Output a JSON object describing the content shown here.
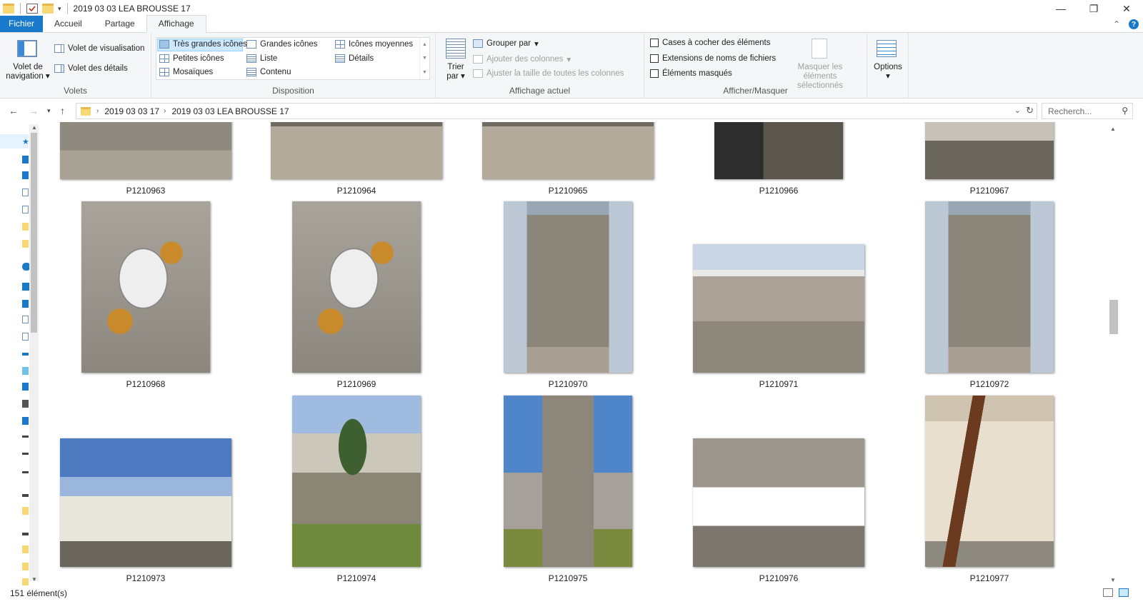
{
  "window": {
    "title": "2019 03 03 LEA BROUSSE 17",
    "controls": {
      "minimize": "—",
      "restore": "❐",
      "close": "✕"
    }
  },
  "ribbon_tabs": [
    {
      "label": "Fichier",
      "active": false
    },
    {
      "label": "Accueil",
      "active": false
    },
    {
      "label": "Partage",
      "active": false
    },
    {
      "label": "Affichage",
      "active": true
    }
  ],
  "ribbon": {
    "volets": {
      "label": "Volets",
      "nav_pane_label": "Volet de navigation",
      "preview_pane": "Volet de visualisation",
      "details_pane": "Volet des détails"
    },
    "disposition": {
      "label": "Disposition",
      "layouts": [
        "Très grandes icônes",
        "Grandes icônes",
        "Icônes moyennes",
        "Petites icônes",
        "Liste",
        "Détails",
        "Mosaïques",
        "Contenu"
      ],
      "selected": "Très grandes icônes"
    },
    "affichage_actuel": {
      "label": "Affichage actuel",
      "sort_by": "Trier par",
      "group_by": "Grouper par",
      "add_columns": "Ajouter des colonnes",
      "size_columns": "Ajuster la taille de toutes les colonnes"
    },
    "afficher_masquer": {
      "label": "Afficher/Masquer",
      "checkboxes": [
        "Cases à cocher des éléments",
        "Extensions de noms de fichiers",
        "Éléments masqués"
      ],
      "hide_selected": "Masquer les éléments sélectionnés"
    },
    "options": {
      "label": "Options"
    }
  },
  "address": {
    "breadcrumbs": [
      "2019 03 03  17",
      "2019 03 03 LEA BROUSSE 17"
    ],
    "search_placeholder": "Recherch..."
  },
  "files": [
    {
      "name": "P1210963",
      "scene": "stone-top"
    },
    {
      "name": "P1210964",
      "scene": "gravel-slab"
    },
    {
      "name": "P1210965",
      "scene": "gravel-slab"
    },
    {
      "name": "P1210966",
      "scene": "dark-stone"
    },
    {
      "name": "P1210967",
      "scene": "stone-cross"
    },
    {
      "name": "P1210968",
      "scene": "lichen-medallion"
    },
    {
      "name": "P1210969",
      "scene": "lichen-medallion"
    },
    {
      "name": "P1210970",
      "scene": "headstone"
    },
    {
      "name": "P1210971",
      "scene": "cemetery-wide"
    },
    {
      "name": "P1210972",
      "scene": "headstone"
    },
    {
      "name": "P1210973",
      "scene": "crosses"
    },
    {
      "name": "P1210974",
      "scene": "tomb-tree"
    },
    {
      "name": "P1210975",
      "scene": "chapel"
    },
    {
      "name": "P1210976",
      "scene": "sign"
    },
    {
      "name": "P1210977",
      "scene": "crypt"
    }
  ],
  "status": {
    "count": "151 élément(s)"
  }
}
